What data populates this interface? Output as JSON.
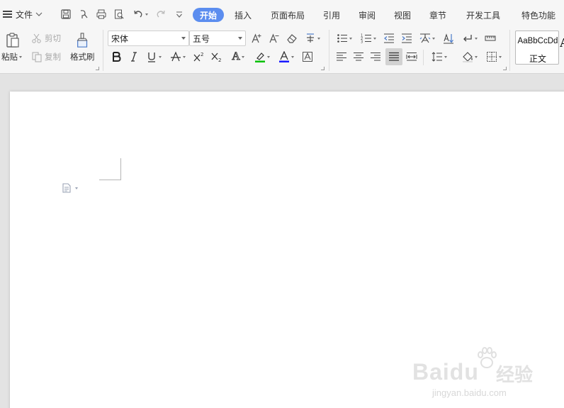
{
  "menu": {
    "file_label": "文件",
    "tabs": [
      {
        "label": "开始",
        "active": true
      },
      {
        "label": "插入"
      },
      {
        "label": "页面布局"
      },
      {
        "label": "引用"
      },
      {
        "label": "审阅"
      },
      {
        "label": "视图"
      },
      {
        "label": "章节"
      },
      {
        "label": "开发工具"
      },
      {
        "label": "特色功能"
      }
    ]
  },
  "clipboard": {
    "paste_label": "粘贴",
    "cut_label": "剪切",
    "copy_label": "复制",
    "format_painter_label": "格式刷"
  },
  "font": {
    "family_value": "宋体",
    "size_value": "五号",
    "text_effect_glyph": "A"
  },
  "styles": {
    "sample_text": "AaBbCcDd",
    "name": "正文",
    "next_sample_glyph": "A"
  },
  "colors": {
    "accent": "#5b8def",
    "highlight": "#00c000",
    "font_color": "#1a1aff",
    "page_bg": "#ffffff",
    "workspace_bg": "#e3e3e3"
  },
  "watermark": {
    "brand": "Baidu",
    "brand_cn": "经验",
    "url": "jingyan.baidu.com"
  }
}
